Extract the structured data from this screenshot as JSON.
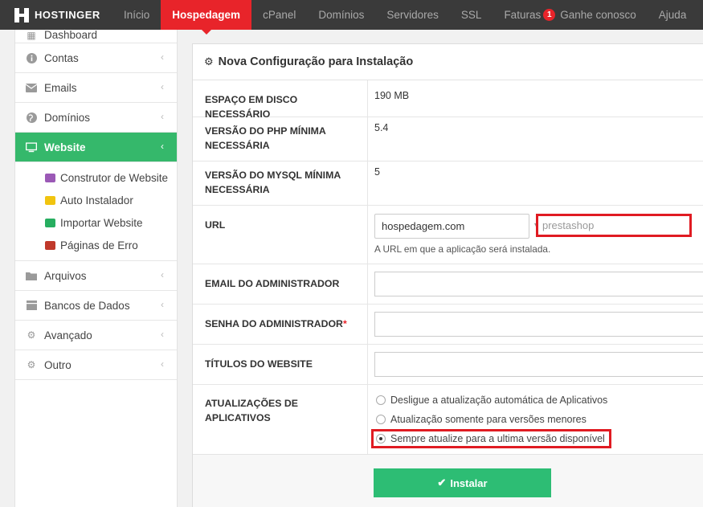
{
  "topbar": {
    "logo": "HOSTINGER",
    "nav": [
      {
        "label": "Início"
      },
      {
        "label": "Hospedagem"
      },
      {
        "label": "cPanel"
      },
      {
        "label": "Domínios"
      },
      {
        "label": "Servidores"
      },
      {
        "label": "SSL"
      },
      {
        "label": "Faturas"
      },
      {
        "label": "Ganhe conosco"
      },
      {
        "label": "Ajuda"
      }
    ],
    "faturas_badge": "1",
    "active_color": "#e8242a"
  },
  "sidebar": {
    "partial_item": "Dashboard",
    "items": [
      {
        "label": "Contas",
        "icon": "info-icon"
      },
      {
        "label": "Emails",
        "icon": "envelope-icon"
      },
      {
        "label": "Domínios",
        "icon": "globe-icon"
      },
      {
        "label": "Website",
        "icon": "monitor-icon"
      }
    ],
    "website_sub": [
      {
        "label": "Construtor de Website",
        "icon": "builder-icon"
      },
      {
        "label": "Auto Instalador",
        "icon": "auto-installer-icon"
      },
      {
        "label": "Importar Website",
        "icon": "import-icon"
      },
      {
        "label": "Páginas de Erro",
        "icon": "error-pages-icon"
      }
    ],
    "items_after": [
      {
        "label": "Arquivos",
        "icon": "folder-icon"
      },
      {
        "label": "Bancos de Dados",
        "icon": "database-icon"
      },
      {
        "label": "Avançado",
        "icon": "cogs-icon"
      },
      {
        "label": "Outro",
        "icon": "gear-icon"
      }
    ],
    "active_color": "#35b86b"
  },
  "panel": {
    "title": "Nova Configuração para Instalação",
    "disk_label": "ESPAÇO EM DISCO NECESSÁRIO",
    "disk_value": "190 MB",
    "php_label": "VERSÃO DO PHP MÍNIMA NECESSÁRIA",
    "php_value": "5.4",
    "mysql_label": "VERSÃO DO MYSQL MÍNIMA NECESSÁRIA",
    "mysql_value": "5",
    "url_label": "URL",
    "url_domain": "hospedagem.com",
    "url_path_placeholder": "prestashop",
    "url_help": "A URL em que a aplicação será instalada.",
    "email_label": "EMAIL DO ADMINISTRADOR",
    "password_label": "SENHA DO ADMINISTRADOR",
    "password_required": "*",
    "titles_label": "TÍTULOS DO WEBSITE",
    "updates_label": "ATUALIZAÇÕES DE APLICATIVOS",
    "update_options": [
      "Desligue a atualização automática de Aplicativos",
      "Atualização somente para versões menores",
      "Sempre atualize para a ultima versão disponível"
    ],
    "install_button": "Instalar",
    "install_color": "#2dbd74"
  }
}
